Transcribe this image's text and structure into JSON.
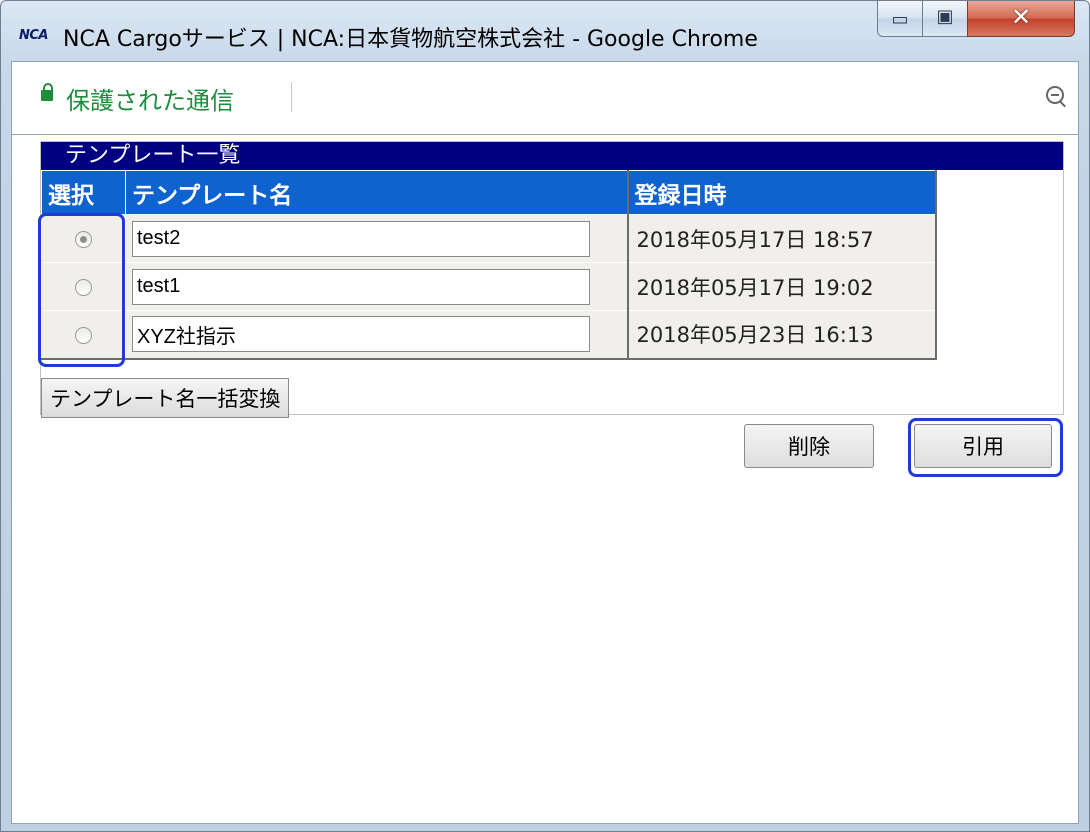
{
  "window": {
    "logo": "NCA",
    "title": "NCA Cargoサービス | NCA:日本貨物航空株式会社 - Google Chrome",
    "minimize_glyph": "▭",
    "maximize_glyph": "▣",
    "close_glyph": "✕"
  },
  "address_bar": {
    "secure_text": "保護された通信",
    "icons": [
      "lock-icon",
      "zoom-out-icon"
    ],
    "secure_color": "#1e8e3e"
  },
  "panel": {
    "header": "テンプレート一覧",
    "header_color": "#000080",
    "columns": [
      "選択",
      "テンプレート名",
      "登録日時"
    ],
    "column_header_color": "#0f63cf",
    "rows": [
      {
        "selected": true,
        "name": "test2",
        "date": "2018年05月17日 18:57"
      },
      {
        "selected": false,
        "name": "test1",
        "date": "2018年05月17日 19:02"
      },
      {
        "selected": false,
        "name": "XYZ社指示",
        "date": "2018年05月23日 16:13"
      }
    ],
    "bulk_rename_label": "テンプレート名一括変換"
  },
  "actions": {
    "delete_label": "削除",
    "quote_label": "引用"
  },
  "highlight_color": "#1f3ad6"
}
